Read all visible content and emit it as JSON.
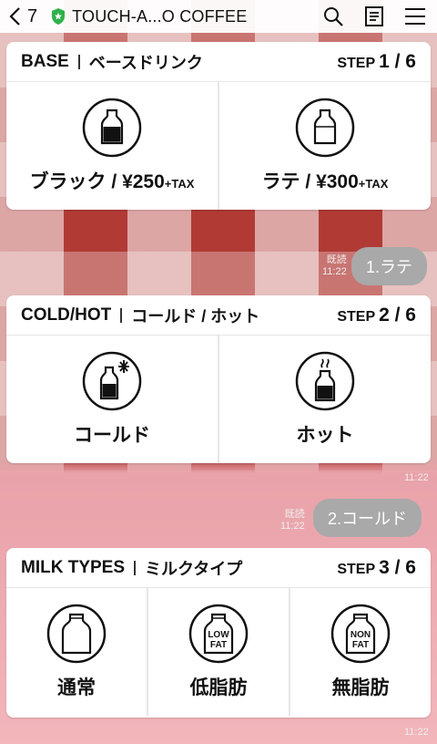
{
  "topbar": {
    "back_count": "7",
    "title": "TOUCH-A...O COFFEE",
    "icons": [
      "back-chevron-icon",
      "shield-icon",
      "search-icon",
      "notes-icon",
      "menu-icon"
    ]
  },
  "cards": [
    {
      "title_en": "BASE",
      "title_jp": "ベースドリンク",
      "step_label": "STEP",
      "step_value": "1 / 6",
      "options": [
        {
          "label": "ブラック / ¥250",
          "suffix": "+TAX",
          "icon": "bottle-black-icon"
        },
        {
          "label": "ラテ / ¥300",
          "suffix": "+TAX",
          "icon": "bottle-latte-icon"
        }
      ]
    },
    {
      "title_en": "COLD/HOT",
      "title_jp": "コールド / ホット",
      "step_label": "STEP",
      "step_value": "2 / 6",
      "options": [
        {
          "label": "コールド",
          "icon": "bottle-cold-icon"
        },
        {
          "label": "ホット",
          "icon": "bottle-hot-icon"
        }
      ]
    },
    {
      "title_en": "MILK TYPES",
      "title_jp": "ミルクタイプ",
      "step_label": "STEP",
      "step_value": "3 / 6",
      "options": [
        {
          "label": "通常",
          "icon": "milk-bottle-icon"
        },
        {
          "label": "低脂肪",
          "badge_line1": "LOW",
          "badge_line2": "FAT",
          "icon": "milk-lowfat-icon"
        },
        {
          "label": "無脂肪",
          "badge_line1": "NON",
          "badge_line2": "FAT",
          "icon": "milk-nonfat-icon"
        }
      ]
    }
  ],
  "messages": [
    {
      "text": "1.ラテ",
      "read": "既読",
      "time": "11:22"
    },
    {
      "text": "2.コールド",
      "read": "既読",
      "time": "11:22"
    }
  ],
  "timestamps": {
    "card2": "11:22",
    "card3": "11:22"
  },
  "colors": {
    "accent_green": "#2eb24a",
    "bubble_gray": "#a9a9a9"
  }
}
